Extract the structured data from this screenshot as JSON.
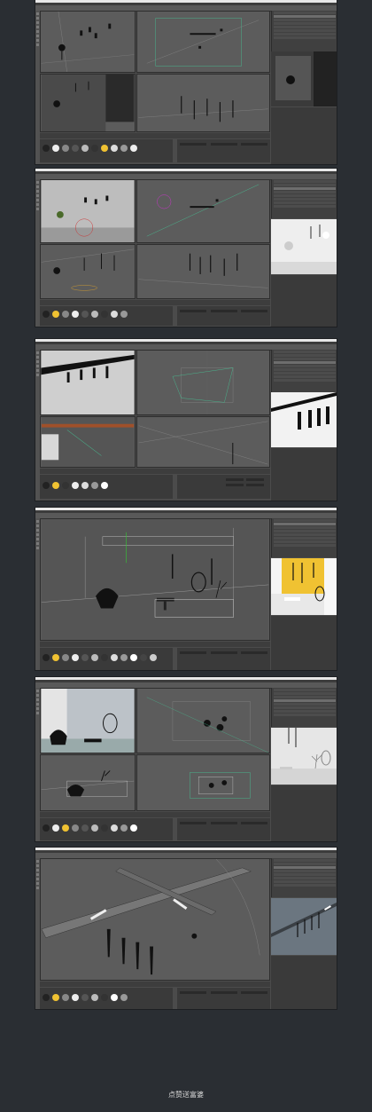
{
  "footer": {
    "text": "点赞送富婆"
  },
  "colors": {
    "background": "#2a2e33",
    "panel": "#4b4b4b",
    "viewport": "#5c5c5c",
    "accent": "#c9a03a",
    "render_white": "#eeeeee",
    "render_yellow": "#f0c232"
  },
  "screens": [
    {
      "name": "screenshot-1",
      "render_label": ""
    },
    {
      "name": "screenshot-2",
      "render_label": ""
    },
    {
      "name": "screenshot-3",
      "render_label": ""
    },
    {
      "name": "screenshot-4",
      "render_label": ""
    },
    {
      "name": "screenshot-5",
      "render_label": ""
    },
    {
      "name": "screenshot-6",
      "render_label": ""
    }
  ]
}
